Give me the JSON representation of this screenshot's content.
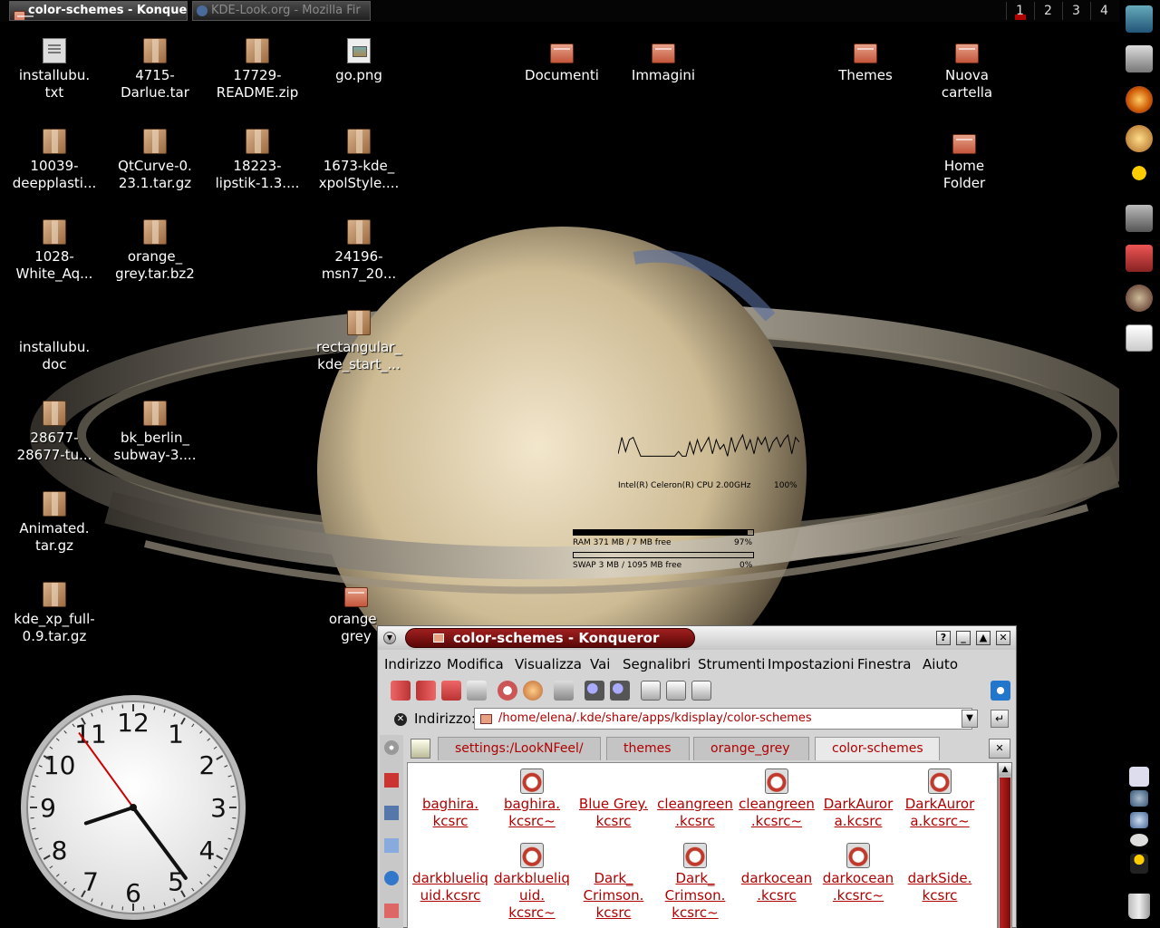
{
  "taskbar": {
    "tasks": [
      {
        "label": "color-schemes - Konque",
        "active": true
      },
      {
        "label": "KDE-Look.org - Mozilla Fir",
        "active": false
      }
    ],
    "pager": [
      "1",
      "2",
      "3",
      "4"
    ]
  },
  "desktop_icons": [
    {
      "label1": "installubu.",
      "label2": "txt",
      "icon": "text-file-icon"
    },
    {
      "label1": "4715-",
      "label2": "Darlue.tar",
      "icon": "archive-icon"
    },
    {
      "label1": "17729-",
      "label2": "README.zip",
      "icon": "archive-icon"
    },
    {
      "label1": "go.png",
      "label2": "",
      "icon": "image-file-icon"
    },
    {
      "label1": "Documenti",
      "label2": "",
      "icon": "folder-icon"
    },
    {
      "label1": "Immagini",
      "label2": "",
      "icon": "folder-icon"
    },
    {
      "label1": "Themes",
      "label2": "",
      "icon": "folder-icon"
    },
    {
      "label1": "Nuova",
      "label2": "cartella",
      "icon": "folder-icon"
    },
    {
      "label1": "10039-",
      "label2": "deepplasti...",
      "icon": "archive-icon"
    },
    {
      "label1": "QtCurve-0.",
      "label2": "23.1.tar.gz",
      "icon": "archive-icon"
    },
    {
      "label1": "18223-",
      "label2": "lipstik-1.3....",
      "icon": "archive-icon"
    },
    {
      "label1": "1673-kde_",
      "label2": "xpolStyle....",
      "icon": "archive-icon"
    },
    {
      "label1": "Home",
      "label2": "Folder",
      "icon": "home-folder-icon"
    },
    {
      "label1": "1028-",
      "label2": "White_Aq...",
      "icon": "archive-icon"
    },
    {
      "label1": "orange_",
      "label2": "grey.tar.bz2",
      "icon": "archive-icon"
    },
    {
      "label1": "24196-",
      "label2": "msn7_20...",
      "icon": "archive-icon"
    },
    {
      "label1": "installubu.",
      "label2": "doc",
      "icon": "document-icon"
    },
    {
      "label1": "rectangular_",
      "label2": "kde_start_...",
      "icon": "archive-icon"
    },
    {
      "label1": "28677-",
      "label2": "28677-tu...",
      "icon": "archive-icon"
    },
    {
      "label1": "bk_berlin_",
      "label2": "subway-3....",
      "icon": "archive-icon"
    },
    {
      "label1": "Animated.",
      "label2": "tar.gz",
      "icon": "archive-icon"
    },
    {
      "label1": "kde_xp_full-",
      "label2": "0.9.tar.gz",
      "icon": "archive-icon"
    },
    {
      "label1": "orange_",
      "label2": "grey",
      "icon": "folder-icon"
    }
  ],
  "monitor": {
    "cpu_label": "Intel(R) Celeron(R) CPU 2.00GHz",
    "cpu_pct": "100%",
    "cpu_samples": [
      0.2,
      0.9,
      0.3,
      0.8,
      0.9,
      0.5,
      0.1,
      0.1,
      0.1,
      0.1,
      0.1,
      0.1,
      0.1,
      0.1,
      0.1,
      0.1,
      0.3,
      0.1,
      0.1,
      0.7,
      0.2,
      0.8,
      0.3,
      0.6,
      0.9,
      0.2,
      0.8,
      0.4,
      0.6,
      0.1,
      0.9,
      0.3,
      0.7,
      1.0,
      0.4,
      0.8,
      0.2,
      0.9,
      0.6,
      0.9,
      0.3,
      0.7,
      0.9,
      0.5,
      0.8,
      1.0,
      0.2,
      0.9,
      0.7
    ],
    "ram_label": "RAM  371 MB / 7 MB free",
    "ram_pct": "97%",
    "ram_fill": 0.97,
    "swap_label": "SWAP  3 MB / 1095 MB free",
    "swap_pct": "0%",
    "swap_fill": 0.0
  },
  "clock": {
    "hour": 8,
    "minute": 23,
    "second": 54,
    "numerals": [
      "12",
      "1",
      "2",
      "3",
      "4",
      "5",
      "6",
      "7",
      "8",
      "9",
      "10",
      "11"
    ]
  },
  "konqueror": {
    "title": "color-schemes - Konqueror",
    "title_buttons": [
      "?",
      "_",
      "▲",
      "✕"
    ],
    "menu": [
      "Indirizzo",
      "Modifica",
      "Visualizza",
      "Vai",
      "Segnalibri",
      "Strumenti",
      "Impostazioni",
      "Finestra",
      "Aiuto"
    ],
    "address_label": "Indirizzo:",
    "address_value": "/home/elena/.kde/share/apps/kdisplay/color-schemes",
    "tabs": [
      {
        "label": "settings:/LookNFeel/",
        "active": false
      },
      {
        "label": "themes",
        "active": false
      },
      {
        "label": "orange_grey",
        "active": false
      },
      {
        "label": "color-schemes",
        "active": true
      }
    ],
    "files": [
      {
        "l1": "baghira.",
        "l2": "kcsrc",
        "l3": "",
        "icon": false
      },
      {
        "l1": "baghira.",
        "l2": "kcsrc~",
        "l3": "",
        "icon": true
      },
      {
        "l1": "Blue Grey.",
        "l2": "kcsrc",
        "l3": "",
        "icon": false
      },
      {
        "l1": "cleangreen",
        "l2": ".kcsrc",
        "l3": "",
        "icon": false
      },
      {
        "l1": "cleangreen",
        "l2": ".kcsrc~",
        "l3": "",
        "icon": true
      },
      {
        "l1": "DarkAuror",
        "l2": "a.kcsrc",
        "l3": "",
        "icon": false
      },
      {
        "l1": "DarkAuror",
        "l2": "a.kcsrc~",
        "l3": "",
        "icon": true
      },
      {
        "l1": "darkblueliq",
        "l2": "uid.kcsrc",
        "l3": "",
        "icon": false
      },
      {
        "l1": "darkblueliq",
        "l2": "uid.",
        "l3": "kcsrc~",
        "icon": true
      },
      {
        "l1": "Dark_",
        "l2": "Crimson.",
        "l3": "kcsrc",
        "icon": false
      },
      {
        "l1": "Dark_",
        "l2": "Crimson.",
        "l3": "kcsrc~",
        "icon": true
      },
      {
        "l1": "darkocean",
        "l2": ".kcsrc",
        "l3": "",
        "icon": false
      },
      {
        "l1": "darkocean",
        "l2": ".kcsrc~",
        "l3": "",
        "icon": true
      },
      {
        "l1": "darkSide.",
        "l2": "kcsrc",
        "l3": "",
        "icon": false
      }
    ]
  },
  "colors": {
    "accent_red": "#b00000",
    "title_red": "#7a0b0b"
  }
}
